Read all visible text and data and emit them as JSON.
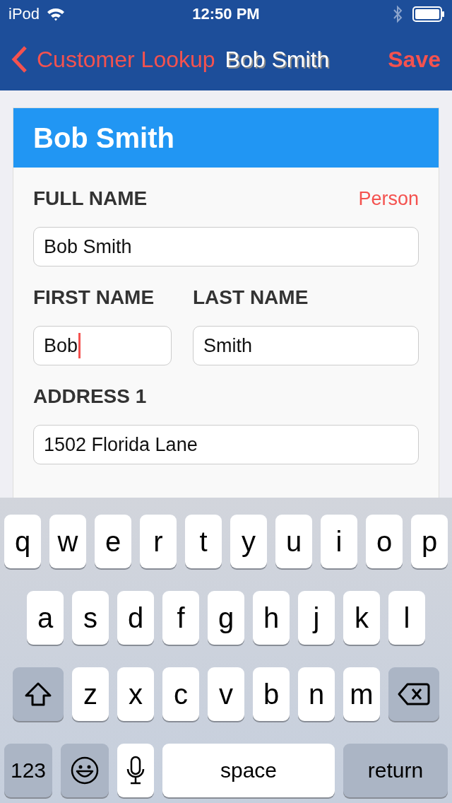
{
  "status_bar": {
    "carrier": "iPod",
    "time": "12:50 PM"
  },
  "nav_bar": {
    "back_label": "Customer Lookup",
    "title": "Bob Smith",
    "action": "Save"
  },
  "card": {
    "title": "Bob Smith",
    "type_label": "Person",
    "rows": [
      {
        "fields": [
          {
            "label": "FULL NAME",
            "value": "Bob Smith",
            "focused": false
          }
        ]
      },
      {
        "fields": [
          {
            "label": "FIRST NAME",
            "value": "Bob",
            "focused": true
          },
          {
            "label": "LAST NAME",
            "value": "Smith",
            "focused": false
          }
        ]
      },
      {
        "fields": [
          {
            "label": "ADDRESS 1",
            "value": "1502 Florida Lane",
            "focused": false
          }
        ]
      }
    ]
  },
  "keyboard": {
    "rows": [
      {
        "keys": [
          {
            "kind": "letter",
            "label": "q"
          },
          {
            "kind": "letter",
            "label": "w"
          },
          {
            "kind": "letter",
            "label": "e"
          },
          {
            "kind": "letter",
            "label": "r"
          },
          {
            "kind": "letter",
            "label": "t"
          },
          {
            "kind": "letter",
            "label": "y"
          },
          {
            "kind": "letter",
            "label": "u"
          },
          {
            "kind": "letter",
            "label": "i"
          },
          {
            "kind": "letter",
            "label": "o"
          },
          {
            "kind": "letter",
            "label": "p"
          }
        ]
      },
      {
        "keys": [
          {
            "kind": "letter",
            "label": "a"
          },
          {
            "kind": "letter",
            "label": "s"
          },
          {
            "kind": "letter",
            "label": "d"
          },
          {
            "kind": "letter",
            "label": "f"
          },
          {
            "kind": "letter",
            "label": "g"
          },
          {
            "kind": "letter",
            "label": "h"
          },
          {
            "kind": "letter",
            "label": "j"
          },
          {
            "kind": "letter",
            "label": "k"
          },
          {
            "kind": "letter",
            "label": "l"
          }
        ]
      },
      {
        "keys": [
          {
            "kind": "shift"
          },
          {
            "kind": "letter",
            "label": "z"
          },
          {
            "kind": "letter",
            "label": "x"
          },
          {
            "kind": "letter",
            "label": "c"
          },
          {
            "kind": "letter",
            "label": "v"
          },
          {
            "kind": "letter",
            "label": "b"
          },
          {
            "kind": "letter",
            "label": "n"
          },
          {
            "kind": "letter",
            "label": "m"
          },
          {
            "kind": "delete"
          }
        ]
      },
      {
        "keys": [
          {
            "kind": "mode",
            "label": "123"
          },
          {
            "kind": "emoji"
          },
          {
            "kind": "mic"
          },
          {
            "kind": "space",
            "label": "space"
          },
          {
            "kind": "return",
            "label": "return"
          }
        ]
      }
    ]
  }
}
